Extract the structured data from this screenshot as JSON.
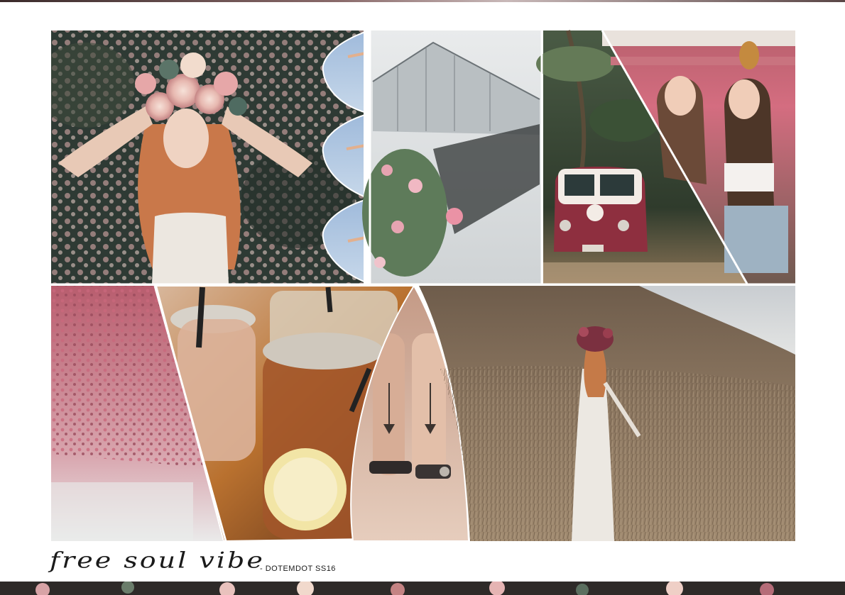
{
  "caption": {
    "script_text": "free soul vibe",
    "brand_text": "- DOTEMDOT SS16"
  },
  "palette": {
    "floral_dark": "#2e3a34",
    "rose": "#d98e9b",
    "hair": "#c9784a",
    "sky": "#a9c3de",
    "van_red": "#8e2f3f",
    "field": "#8b7660",
    "border": "#ffffff"
  },
  "photos": [
    {
      "icon": "flower-crown-portrait"
    },
    {
      "icon": "hands-sky-sliver"
    },
    {
      "icon": "greenhouse-window"
    },
    {
      "icon": "palm-vw-van"
    },
    {
      "icon": "friends-selfie-pineapple"
    },
    {
      "icon": "hanging-wisteria"
    },
    {
      "icon": "mason-jar-drinks"
    },
    {
      "icon": "hand-tattoos"
    },
    {
      "icon": "woman-in-field"
    }
  ]
}
